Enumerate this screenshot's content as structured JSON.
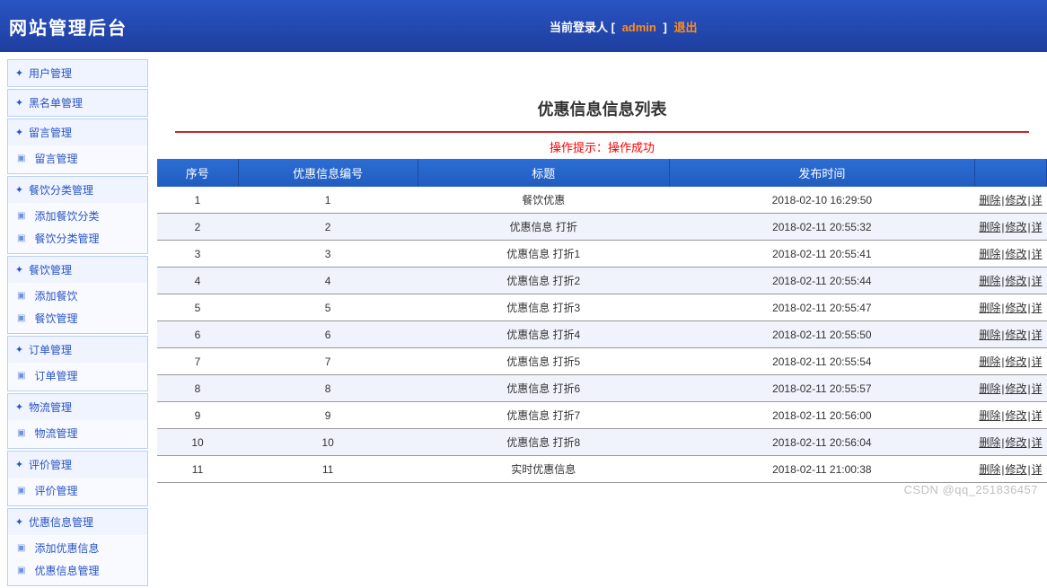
{
  "header": {
    "title": "网站管理后台",
    "login_prefix": "当前登录人   [",
    "login_user": "admin",
    "login_suffix": "]",
    "logout": "退出"
  },
  "sidebar": [
    {
      "label": "用户管理",
      "subs": []
    },
    {
      "label": "黑名单管理",
      "subs": []
    },
    {
      "label": "留言管理",
      "subs": [
        {
          "label": "留言管理"
        }
      ]
    },
    {
      "label": "餐饮分类管理",
      "subs": [
        {
          "label": "添加餐饮分类"
        },
        {
          "label": "餐饮分类管理"
        }
      ]
    },
    {
      "label": "餐饮管理",
      "subs": [
        {
          "label": "添加餐饮"
        },
        {
          "label": "餐饮管理"
        }
      ]
    },
    {
      "label": "订单管理",
      "subs": [
        {
          "label": "订单管理"
        }
      ]
    },
    {
      "label": "物流管理",
      "subs": [
        {
          "label": "物流管理"
        }
      ]
    },
    {
      "label": "评价管理",
      "subs": [
        {
          "label": "评价管理"
        }
      ]
    },
    {
      "label": "优惠信息管理",
      "subs": [
        {
          "label": "添加优惠信息"
        },
        {
          "label": "优惠信息管理"
        }
      ]
    }
  ],
  "main": {
    "page_title": "优惠信息信息列表",
    "tip": "操作提示：操作成功",
    "columns": {
      "seq": "序号",
      "code": "优惠信息编号",
      "title": "标题",
      "time": "发布时间"
    },
    "ops": {
      "delete": "删除",
      "edit": "修改",
      "detail": "详"
    },
    "rows": [
      {
        "seq": "1",
        "code": "1",
        "title": "餐饮优惠",
        "time": "2018-02-10 16:29:50"
      },
      {
        "seq": "2",
        "code": "2",
        "title": "优惠信息 打折",
        "time": "2018-02-11 20:55:32"
      },
      {
        "seq": "3",
        "code": "3",
        "title": "优惠信息 打折1",
        "time": "2018-02-11 20:55:41"
      },
      {
        "seq": "4",
        "code": "4",
        "title": "优惠信息 打折2",
        "time": "2018-02-11 20:55:44"
      },
      {
        "seq": "5",
        "code": "5",
        "title": "优惠信息 打折3",
        "time": "2018-02-11 20:55:47"
      },
      {
        "seq": "6",
        "code": "6",
        "title": "优惠信息 打折4",
        "time": "2018-02-11 20:55:50"
      },
      {
        "seq": "7",
        "code": "7",
        "title": "优惠信息 打折5",
        "time": "2018-02-11 20:55:54"
      },
      {
        "seq": "8",
        "code": "8",
        "title": "优惠信息 打折6",
        "time": "2018-02-11 20:55:57"
      },
      {
        "seq": "9",
        "code": "9",
        "title": "优惠信息 打折7",
        "time": "2018-02-11 20:56:00"
      },
      {
        "seq": "10",
        "code": "10",
        "title": "优惠信息 打折8",
        "time": "2018-02-11 20:56:04"
      },
      {
        "seq": "11",
        "code": "11",
        "title": "实时优惠信息",
        "time": "2018-02-11 21:00:38"
      }
    ]
  },
  "watermark": "CSDN @qq_251836457"
}
